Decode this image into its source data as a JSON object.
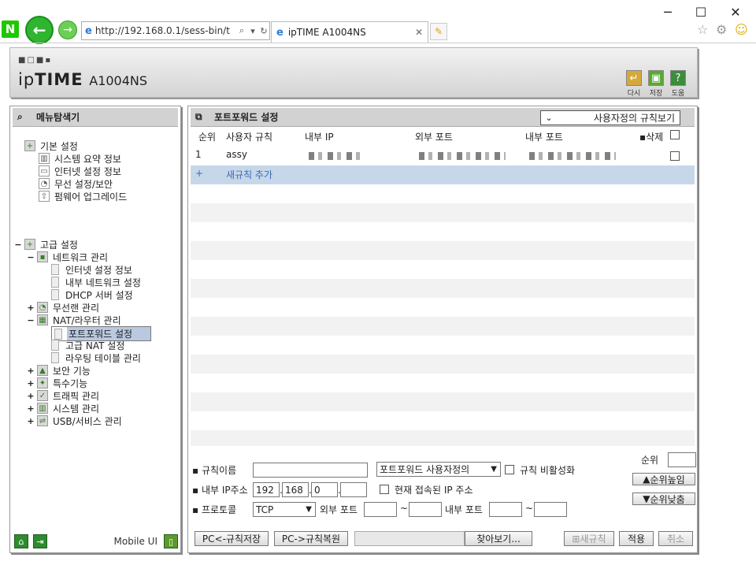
{
  "browser": {
    "address": "http://192.168.0.1/sess-bin/t",
    "tab_title": "ipTIME A1004NS"
  },
  "router": {
    "brand_light": "ip",
    "brand_bold": "TIME",
    "model": "A1004NS",
    "header_buttons": [
      "다시",
      "저장",
      "도움"
    ]
  },
  "sidebar": {
    "title": "메뉴탐색기",
    "basic": {
      "label": "기본 설정",
      "items": [
        "시스템 요약 정보",
        "인터넷 설정 정보",
        "무선 설정/보안",
        "펌웨어 업그레이드"
      ]
    },
    "advanced": {
      "label": "고급 설정",
      "network": {
        "label": "네트워크 관리",
        "items": [
          "인터넷 설정 정보",
          "내부 네트워크 설정",
          "DHCP 서버 설정"
        ]
      },
      "wireless": "무선랜 관리",
      "nat": {
        "label": "NAT/라우터 관리",
        "items": [
          "포트포워드 설정",
          "고급 NAT 설정",
          "라우팅 테이블 관리"
        ]
      },
      "others": [
        "보안 기능",
        "특수기능",
        "트래픽 관리",
        "시스템 관리",
        "USB/서비스 관리"
      ]
    },
    "mobile_label": "Mobile UI"
  },
  "main": {
    "title": "포트포워드 설정",
    "view_select": "사용자정의 규칙보기",
    "columns": [
      "순위",
      "사용자 규칙",
      "내부 IP",
      "외부 포트",
      "내부 포트",
      "삭제"
    ],
    "rows": [
      {
        "rank": "1",
        "name": "assy"
      }
    ],
    "add_rule": "새규칙 추가",
    "form": {
      "rule_name_label": "규칙이름",
      "rule_name_value": "",
      "rule_type": "포트포워드 사용자정의",
      "disable_label": "규칙 비활성화",
      "ip_label": "내부 IP주소",
      "ip": [
        "192",
        "168",
        "0",
        ""
      ],
      "current_ip_label": "현재 접속된 IP 주소",
      "protocol_label": "프로토콜",
      "protocol": "TCP",
      "ext_port_label": "외부 포트",
      "int_port_label": "내부 포트",
      "tilde": "~",
      "rank_label": "순위",
      "rank_value": "",
      "up_btn": "순위높임",
      "down_btn": "순위낮춤"
    },
    "bottom": {
      "save_btn": "PC<-규칙저장",
      "restore_btn": "PC->규칙복원",
      "browse_btn": "찾아보기...",
      "new_rule_btn": "새규칙",
      "apply_btn": "적용",
      "cancel_btn": "취소"
    }
  },
  "colors": {
    "selected_item": "#b9c9e0",
    "add_row": "#c7d7ea",
    "panel_title": "#d2d2d2"
  }
}
